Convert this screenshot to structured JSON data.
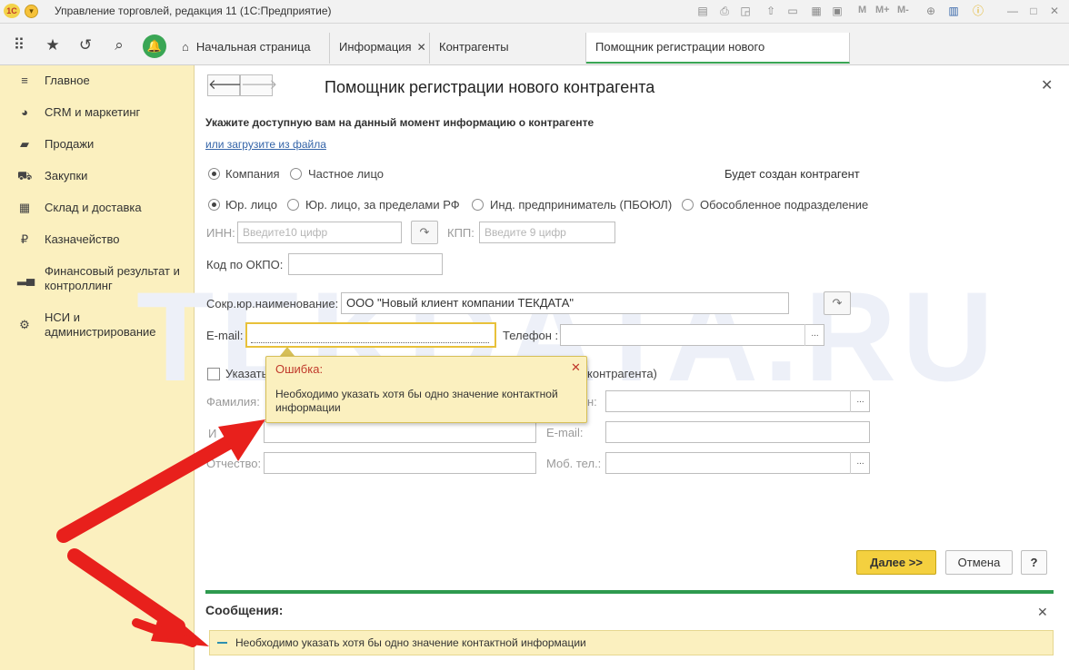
{
  "window": {
    "logo_text": "1С",
    "title": "Управление торговлей, редакция 11  (1С:Предприятие)",
    "toolbar_texts": [
      "M",
      "M+",
      "M-"
    ]
  },
  "tabs": [
    {
      "label": "Начальная страница",
      "closable": false
    },
    {
      "label": "Информация",
      "closable": true
    },
    {
      "label": "Контрагенты (Клиенты)",
      "closable": true
    },
    {
      "label": "Помощник регистрации нового контрагента",
      "closable": true
    }
  ],
  "sidebar": {
    "items": [
      {
        "icon": "menu-icon",
        "label": "Главное"
      },
      {
        "icon": "crm-pie-icon",
        "label": "CRM и маркетинг"
      },
      {
        "icon": "shopping-bag-icon",
        "label": "Продажи"
      },
      {
        "icon": "cart-icon",
        "label": "Закупки"
      },
      {
        "icon": "warehouse-grid-icon",
        "label": "Склад и доставка"
      },
      {
        "icon": "ruble-coin-icon",
        "label": "Казначейство"
      },
      {
        "icon": "bar-chart-icon",
        "label": "Финансовый результат и контроллинг"
      },
      {
        "icon": "gear-icon",
        "label": "НСИ и администрирование"
      }
    ]
  },
  "form": {
    "title": "Помощник регистрации нового контрагента",
    "hint": "Укажите доступную вам на данный момент информацию о контрагенте",
    "load_link": "или загрузите из файла",
    "type_options": [
      {
        "label": "Компания",
        "selected": true
      },
      {
        "label": "Частное лицо",
        "selected": false
      }
    ],
    "will_create": "Будет создан контрагент",
    "legal_options": [
      {
        "label": "Юр. лицо",
        "selected": true
      },
      {
        "label": "Юр. лицо, за пределами РФ",
        "selected": false
      },
      {
        "label": "Инд. предприниматель (ПБОЮЛ)",
        "selected": false
      },
      {
        "label": "Обособленное подразделение",
        "selected": false
      }
    ],
    "inn_label": "ИНН:",
    "inn_placeholder": "Введите10 цифр",
    "kpp_label": "КПП:",
    "kpp_placeholder": "Введите 9 цифр",
    "okpo_label": "Код по ОКПО:",
    "okpo_value": "",
    "short_name_label": "Сокр.юр.наименование:",
    "short_name_value": "ООО \"Новый клиент компании ТЕКДАТА\"",
    "email_label": "E-mail:",
    "email_value": "",
    "phone_label": "Телефон :",
    "phone_value": "",
    "contact_checkbox_label_start": "Указать",
    "contact_checkbox_label_end": "контрагента)",
    "contact_checked": false,
    "contact_fields_left": [
      "Фамилия:",
      "И",
      "Отчество:"
    ],
    "contact_fields_right": [
      "н:",
      "E-mail:",
      "Моб. тел.:"
    ]
  },
  "error_popup": {
    "title": "Ошибка:",
    "text": "Необходимо указать хотя бы одно значение контактной информации"
  },
  "buttons": {
    "next": "Далее >>",
    "cancel": "Отмена",
    "help": "?"
  },
  "messages": {
    "title": "Сообщения:",
    "items": [
      "Необходимо указать хотя бы одно значение контактной информации"
    ]
  },
  "watermark": "TEKDATA.RU",
  "colors": {
    "accent_green": "#2e9a4f",
    "sidebar_bg": "#fbf0bf",
    "error_red": "#c0392b",
    "annotation_arrow": "#e8201c"
  }
}
